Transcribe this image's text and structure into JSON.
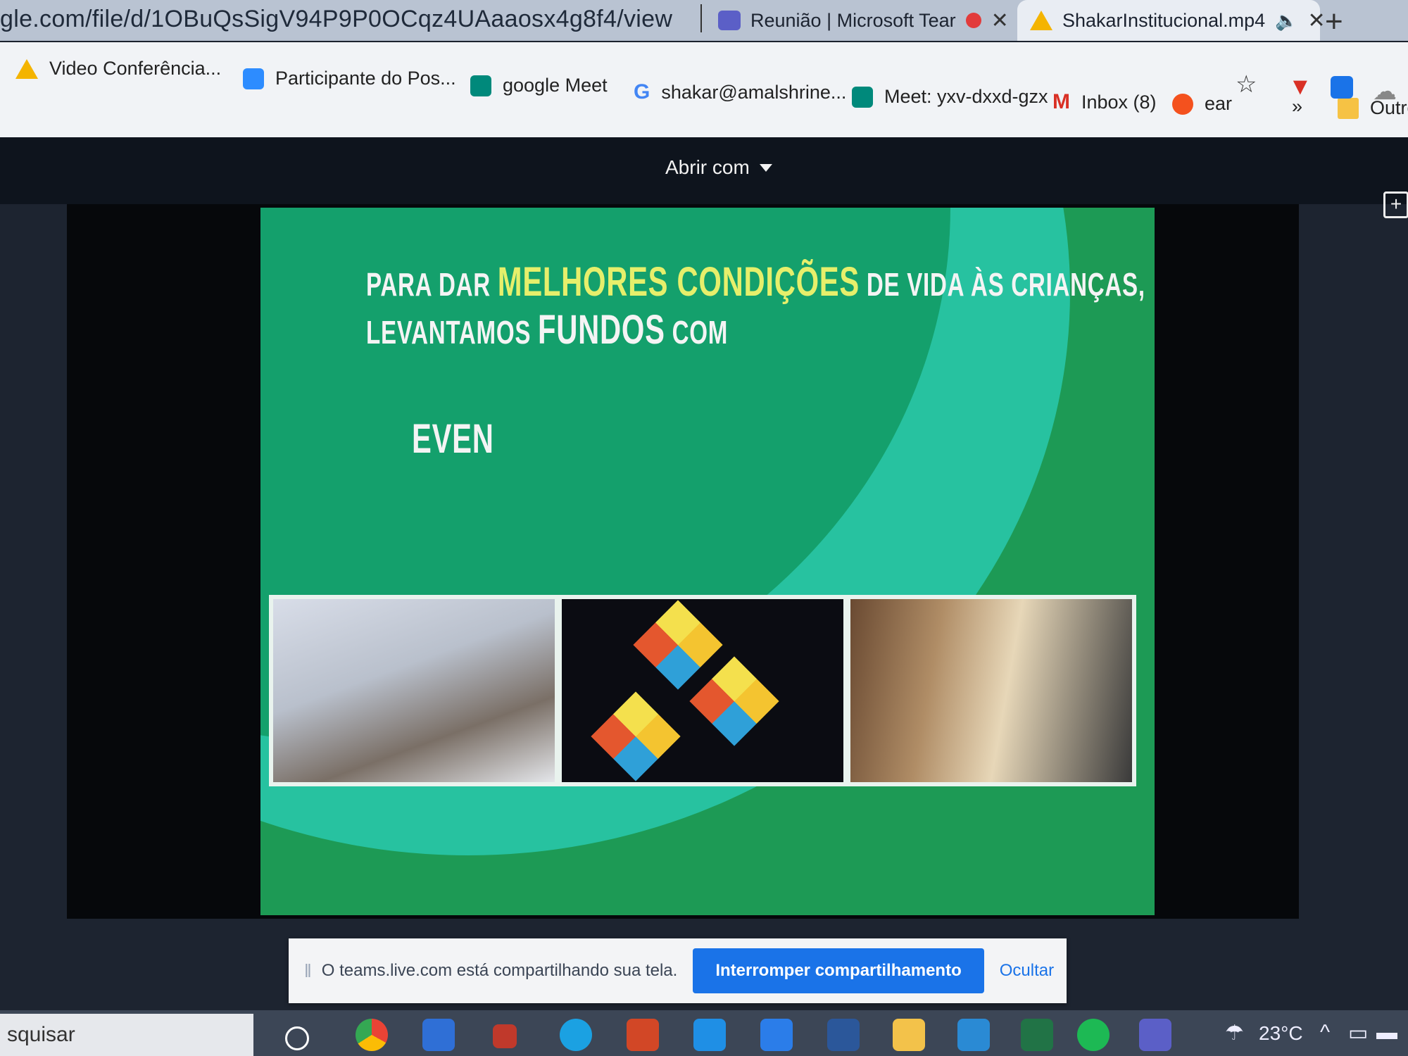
{
  "browser": {
    "url": "gle.com/file/d/1OBuQsSigV94P9P0OCqz4UAaaosx4g8f4/view",
    "tabs": [
      {
        "label": "Reunião | Microsoft Tear"
      },
      {
        "label": "ShakarInstitucional.mp4"
      }
    ],
    "new_tab_symbol": "+",
    "close_symbol": "✕"
  },
  "bookmarks": [
    {
      "label": "Video Conferência...",
      "icon": "google-drive-icon"
    },
    {
      "label": "Participante do Pos...",
      "icon": "zoom-icon"
    },
    {
      "label": "google Meet",
      "icon": "google-meet-icon"
    },
    {
      "label": "shakar@amalshrine...",
      "icon": "google-icon"
    },
    {
      "label": "Meet: yxv-dxxd-gzx",
      "icon": "google-meet-icon"
    },
    {
      "label": "Inbox (8)",
      "icon": "gmail-icon"
    },
    {
      "label": "ear",
      "icon": "orange-circle-icon"
    },
    {
      "label": "Outros",
      "icon": "folder-icon"
    }
  ],
  "bookmarks_more": "»",
  "viewer": {
    "open_with": "Abrir com"
  },
  "slide": {
    "line1": {
      "part1": "Para dar",
      "part2": "melhores condições",
      "part3": "de vida às crianças,"
    },
    "line2": {
      "part1": "levantamos",
      "part2": "fundos",
      "part3": "com"
    },
    "line3": "Even"
  },
  "share_bar": {
    "message": "O teams.live.com está compartilhando sua tela.",
    "stop_button": "Interromper compartilhamento",
    "hide_link": "Ocultar"
  },
  "taskbar": {
    "search_text": "squisar",
    "temperature": "23°C"
  },
  "colors": {
    "slide_green": "#1d9a55",
    "slide_arc": "#27c2a0",
    "highlight_yellow": "#e6ef6b",
    "share_blue": "#1a73e8"
  }
}
